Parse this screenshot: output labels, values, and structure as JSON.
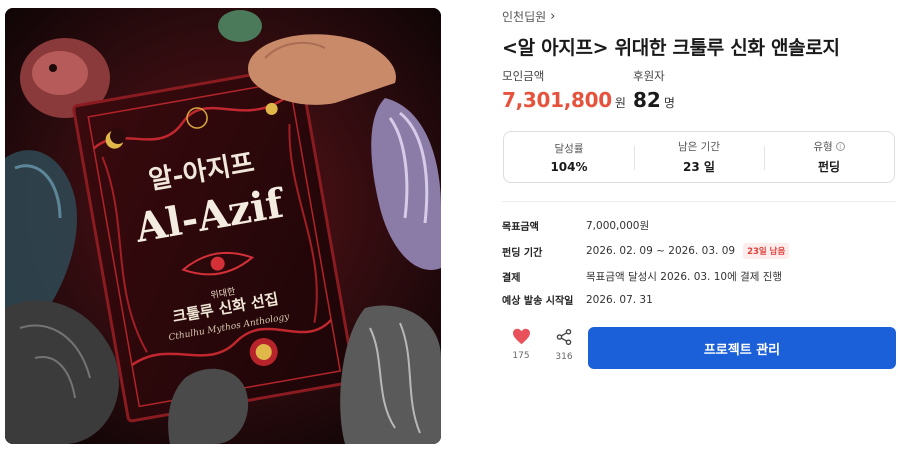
{
  "cover": {
    "korean_title": "알-아지프",
    "latin_title": "Al-Azif",
    "subtitle_small": "위대한",
    "subtitle_main": "크툴루 신화 선집",
    "subtitle_latin": "Cthulhu Mythos Anthology"
  },
  "creator": {
    "name": "인천딥원"
  },
  "project": {
    "title": "<알 아지프> 위대한 크툴루 신화 앤솔로지"
  },
  "stats": {
    "raised_label": "모인금액",
    "raised_value": "7,301,800",
    "raised_unit": "원",
    "backers_label": "후원자",
    "backers_value": "82",
    "backers_unit": "명"
  },
  "summary": {
    "rate_label": "달성률",
    "rate_value": "104%",
    "remaining_label": "남은 기간",
    "remaining_value": "23 일",
    "type_label": "유형",
    "type_value": "펀딩"
  },
  "details": {
    "goal_label": "목표금액",
    "goal_value": "7,000,000원",
    "period_label": "펀딩 기간",
    "period_value": "2026. 02. 09 ~ 2026. 03. 09",
    "dday_badge": "23일 남음",
    "payment_label": "결제",
    "payment_value": "목표금액 달성시 2026. 03. 10에 결제 진행",
    "shipping_label": "예상 발송 시작일",
    "shipping_value": "2026. 07. 31"
  },
  "actions": {
    "like_count": "175",
    "share_count": "316",
    "manage_label": "프로젝트 관리"
  },
  "colors": {
    "accent_red": "#e5533d",
    "button_blue": "#1b5fd9",
    "heart": "#e8525a"
  },
  "icons": [
    "heart-icon",
    "share-icon",
    "info-icon",
    "chevron-right-icon"
  ]
}
